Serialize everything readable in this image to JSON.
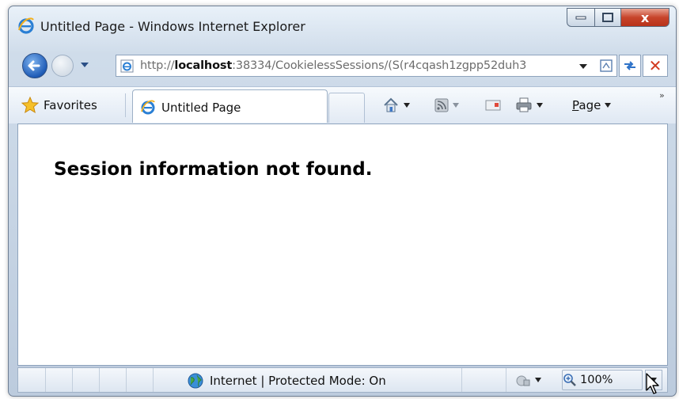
{
  "window": {
    "title": "Untitled Page - Windows Internet Explorer",
    "close_glyph": "x"
  },
  "address": {
    "url_prefix": "http://",
    "url_host": "localhost",
    "url_rest": ":38334/CookielessSessions/(S(r4cqash1zgpp52duh3"
  },
  "toolbar": {
    "stop_glyph": "✕",
    "page_label_key": "P",
    "page_label_rest": "age",
    "chevrons": "»"
  },
  "favorites": {
    "label": "Favorites"
  },
  "tab": {
    "label": "Untitled Page"
  },
  "content": {
    "message": "Session information not found."
  },
  "status": {
    "zone": "Internet | Protected Mode: On",
    "zoom": "100%"
  },
  "colors": {
    "close_red": "#c7442b",
    "ie_blue": "#1f5cb7",
    "frame": "#bccbdd"
  }
}
